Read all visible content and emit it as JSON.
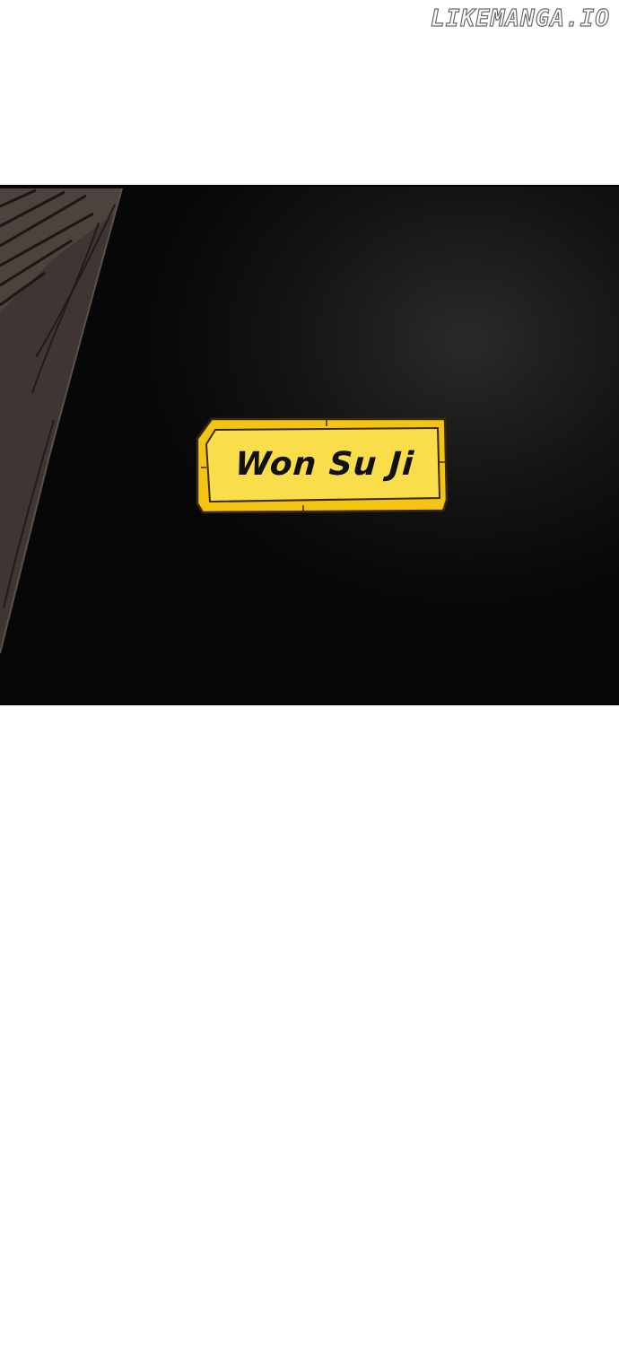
{
  "watermark": {
    "text": "LIKEMANGA.IO"
  },
  "panel": {
    "name_tag": {
      "text": "Won Su Ji",
      "fill_color": "#f5cc1a",
      "border_color": "#3a2a10"
    },
    "background_color": "#0d0d0d",
    "figure_color": "#4a3f3b"
  }
}
